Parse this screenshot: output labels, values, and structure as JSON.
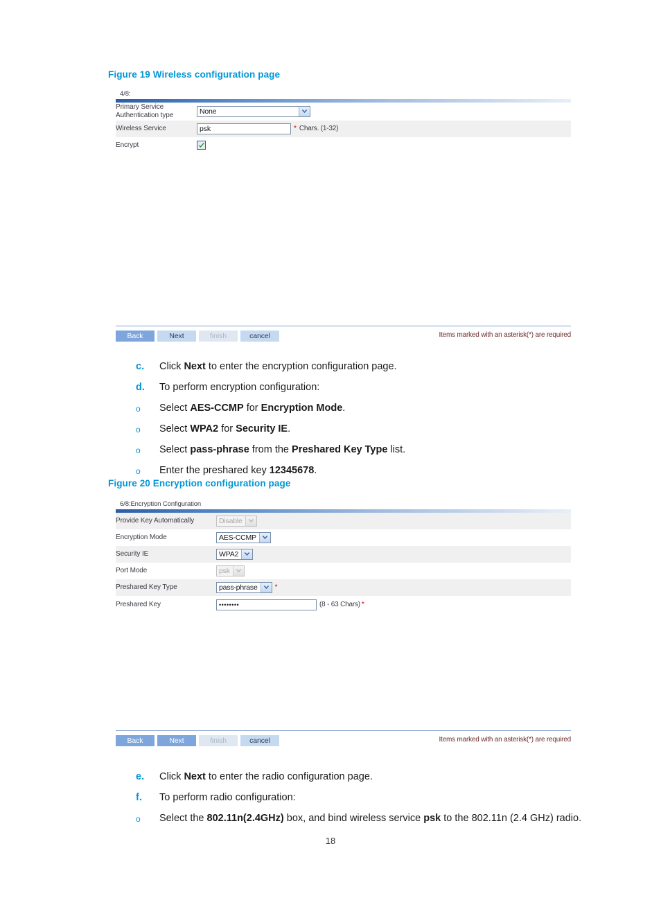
{
  "document": {
    "page_number": "18"
  },
  "figure19": {
    "caption": "Figure 19 Wireless configuration page",
    "panel": {
      "step": "4/8:",
      "rows": [
        {
          "label_line1": "Primary Service",
          "label_line2": "Authentication type",
          "control": "select",
          "value": "None"
        },
        {
          "label_line1": "Wireless Service",
          "control": "text",
          "value": "psk",
          "hint": "Chars. (1-32)"
        },
        {
          "label_line1": "Encrypt",
          "control": "checkbox",
          "checked": true
        }
      ],
      "buttons": [
        {
          "label": "Back",
          "state": "primary"
        },
        {
          "label": "Next",
          "state": "normal"
        },
        {
          "label": "finish",
          "state": "disabled"
        },
        {
          "label": "cancel",
          "state": "normal"
        }
      ],
      "required_note": "Items marked with an asterisk(*) are required"
    }
  },
  "steps_cd": [
    {
      "marker": "c.",
      "marker_type": "alpha",
      "text_html": "Click <b>Next</b> to enter the encryption configuration page."
    },
    {
      "marker": "d.",
      "marker_type": "alpha",
      "text_html": "To perform encryption configuration:"
    },
    {
      "marker": "o",
      "marker_type": "circle",
      "text_html": "Select <b>AES-CCMP</b> for <b>Encryption Mode</b>."
    },
    {
      "marker": "o",
      "marker_type": "circle",
      "text_html": "Select <b>WPA2</b> for <b>Security IE</b>."
    },
    {
      "marker": "o",
      "marker_type": "circle",
      "text_html": "Select <b>pass-phrase</b> from the <b>Preshared Key Type</b> list."
    },
    {
      "marker": "o",
      "marker_type": "circle",
      "text_html": "Enter the preshared key <b>12345678</b>."
    }
  ],
  "figure20": {
    "caption": "Figure 20 Encryption configuration page",
    "panel": {
      "step": "6/8:Encryption Configuration",
      "rows": [
        {
          "label_line1": "Provide Key Automatically",
          "control": "select-disabled",
          "value": "Disable"
        },
        {
          "label_line1": "Encryption Mode",
          "control": "select",
          "value": "AES-CCMP"
        },
        {
          "label_line1": "Security IE",
          "control": "select",
          "value": "WPA2"
        },
        {
          "label_line1": "Port Mode",
          "control": "select-disabled",
          "value": "psk"
        },
        {
          "label_line1": "Preshared Key Type",
          "control": "select",
          "value": "pass-phrase",
          "required": true
        },
        {
          "label_line1": "Preshared Key",
          "control": "password",
          "value": "••••••••",
          "hint": "(8 - 63 Chars)",
          "required": true
        }
      ],
      "buttons": [
        {
          "label": "Back",
          "state": "primary"
        },
        {
          "label": "Next",
          "state": "primary"
        },
        {
          "label": "finish",
          "state": "disabled"
        },
        {
          "label": "cancel",
          "state": "normal"
        }
      ],
      "required_note": "Items marked with an asterisk(*) are required"
    }
  },
  "steps_ef": [
    {
      "marker": "e.",
      "marker_type": "alpha",
      "text_html": "Click <b>Next</b> to enter the radio configuration page."
    },
    {
      "marker": "f.",
      "marker_type": "alpha",
      "text_html": "To perform radio configuration:"
    },
    {
      "marker": "o",
      "marker_type": "circle",
      "text_html": "Select the <b>802.11n(2.4GHz)</b> box, and bind wireless service <b>psk</b> to the 802.11n (2.4 GHz) radio."
    }
  ],
  "colors": {
    "accent_cyan": "#0096d6",
    "panel_header_blue": "#2b5ca5",
    "required_red": "#cc0000",
    "note_maroon": "#6b2d2d"
  }
}
